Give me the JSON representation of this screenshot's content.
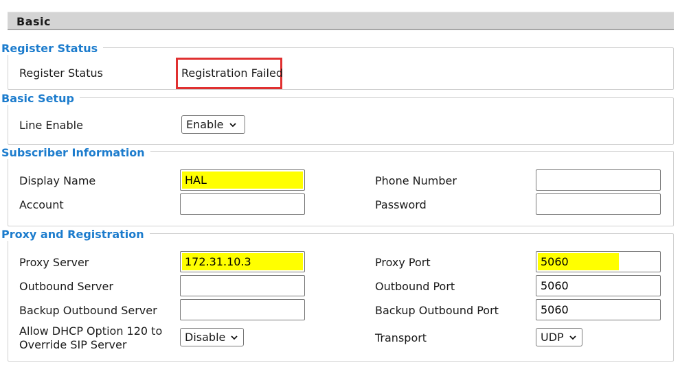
{
  "header": {
    "title": "Basic"
  },
  "register_status": {
    "section_title": "Register Status",
    "label": "Register Status",
    "value": "Registration Failed"
  },
  "basic_setup": {
    "section_title": "Basic Setup",
    "line_enable_label": "Line Enable",
    "line_enable_value": "Enable"
  },
  "subscriber": {
    "section_title": "Subscriber Information",
    "display_name_label": "Display Name",
    "display_name_value": "HAL",
    "phone_number_label": "Phone Number",
    "phone_number_value": "",
    "account_label": "Account",
    "account_value": "",
    "password_label": "Password",
    "password_value": ""
  },
  "proxy": {
    "section_title": "Proxy and Registration",
    "proxy_server_label": "Proxy Server",
    "proxy_server_value": "172.31.10.3",
    "proxy_port_label": "Proxy Port",
    "proxy_port_value": "5060",
    "outbound_server_label": "Outbound Server",
    "outbound_server_value": "",
    "outbound_port_label": "Outbound Port",
    "outbound_port_value": "5060",
    "backup_outbound_server_label": "Backup Outbound Server",
    "backup_outbound_server_value": "",
    "backup_outbound_port_label": "Backup Outbound Port",
    "backup_outbound_port_value": "5060",
    "dhcp_label_line1": "Allow DHCP Option 120 to",
    "dhcp_label_line2": "Override SIP Server",
    "dhcp_value": "Disable",
    "transport_label": "Transport",
    "transport_value": "UDP"
  },
  "colors": {
    "section_title": "#1c7ccd",
    "highlight": "#ffff00",
    "status_outline": "#e03030",
    "header_bg": "#d4d4d4"
  }
}
